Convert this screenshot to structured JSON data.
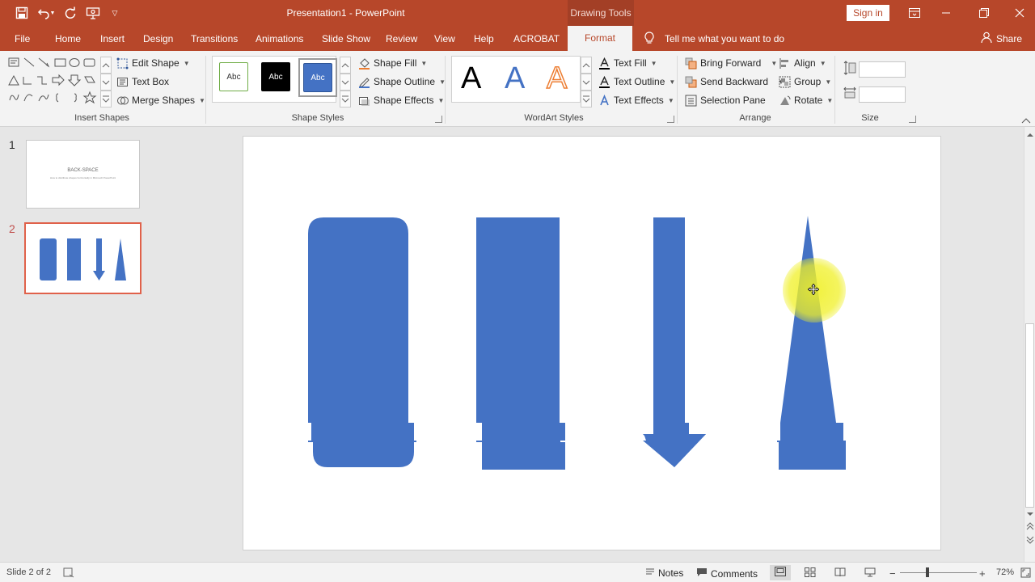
{
  "titlebar": {
    "title": "Presentation1  -  PowerPoint",
    "context_tab_group": "Drawing Tools",
    "sign_in": "Sign in"
  },
  "tabs": [
    {
      "label": "File"
    },
    {
      "label": "Home"
    },
    {
      "label": "Insert"
    },
    {
      "label": "Design"
    },
    {
      "label": "Transitions"
    },
    {
      "label": "Animations"
    },
    {
      "label": "Slide Show"
    },
    {
      "label": "Review"
    },
    {
      "label": "View"
    },
    {
      "label": "Help"
    },
    {
      "label": "ACROBAT"
    },
    {
      "label": "Format"
    }
  ],
  "tell_me": "Tell me what you want to do",
  "share": "Share",
  "ribbon": {
    "insert_shapes": {
      "label": "Insert Shapes",
      "edit_shape": "Edit Shape",
      "text_box": "Text Box",
      "merge_shapes": "Merge Shapes"
    },
    "shape_styles": {
      "label": "Shape Styles",
      "presets": [
        "Abc",
        "Abc",
        "Abc"
      ],
      "shape_fill": "Shape Fill",
      "shape_outline": "Shape Outline",
      "shape_effects": "Shape Effects"
    },
    "wordart_styles": {
      "label": "WordArt Styles",
      "letter": "A",
      "text_fill": "Text Fill",
      "text_outline": "Text Outline",
      "text_effects": "Text Effects"
    },
    "arrange": {
      "label": "Arrange",
      "bring_forward": "Bring Forward",
      "send_backward": "Send Backward",
      "selection_pane": "Selection Pane",
      "align": "Align",
      "group": "Group",
      "rotate": "Rotate"
    },
    "size": {
      "label": "Size",
      "height": "",
      "width": ""
    }
  },
  "slides": [
    {
      "number": "1",
      "title": "BACK-SPACE",
      "subtitle": "How to distribute shapes horizontally in Microsoft PowerPoint"
    },
    {
      "number": "2"
    }
  ],
  "status": {
    "slide_info": "Slide 2 of 2",
    "notes": "Notes",
    "comments": "Comments",
    "zoom": "72%"
  },
  "colors": {
    "accent": "#b7472a",
    "shape_fill": "#4472c4"
  }
}
